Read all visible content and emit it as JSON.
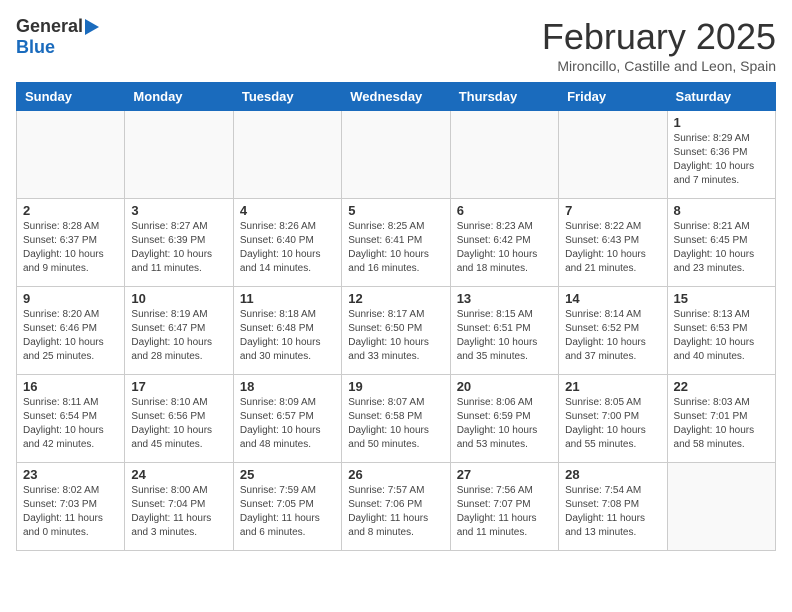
{
  "header": {
    "logo_general": "General",
    "logo_blue": "Blue",
    "title": "February 2025",
    "subtitle": "Mironcillo, Castille and Leon, Spain"
  },
  "weekdays": [
    "Sunday",
    "Monday",
    "Tuesday",
    "Wednesday",
    "Thursday",
    "Friday",
    "Saturday"
  ],
  "weeks": [
    [
      {
        "day": "",
        "info": ""
      },
      {
        "day": "",
        "info": ""
      },
      {
        "day": "",
        "info": ""
      },
      {
        "day": "",
        "info": ""
      },
      {
        "day": "",
        "info": ""
      },
      {
        "day": "",
        "info": ""
      },
      {
        "day": "1",
        "info": "Sunrise: 8:29 AM\nSunset: 6:36 PM\nDaylight: 10 hours and 7 minutes."
      }
    ],
    [
      {
        "day": "2",
        "info": "Sunrise: 8:28 AM\nSunset: 6:37 PM\nDaylight: 10 hours and 9 minutes."
      },
      {
        "day": "3",
        "info": "Sunrise: 8:27 AM\nSunset: 6:39 PM\nDaylight: 10 hours and 11 minutes."
      },
      {
        "day": "4",
        "info": "Sunrise: 8:26 AM\nSunset: 6:40 PM\nDaylight: 10 hours and 14 minutes."
      },
      {
        "day": "5",
        "info": "Sunrise: 8:25 AM\nSunset: 6:41 PM\nDaylight: 10 hours and 16 minutes."
      },
      {
        "day": "6",
        "info": "Sunrise: 8:23 AM\nSunset: 6:42 PM\nDaylight: 10 hours and 18 minutes."
      },
      {
        "day": "7",
        "info": "Sunrise: 8:22 AM\nSunset: 6:43 PM\nDaylight: 10 hours and 21 minutes."
      },
      {
        "day": "8",
        "info": "Sunrise: 8:21 AM\nSunset: 6:45 PM\nDaylight: 10 hours and 23 minutes."
      }
    ],
    [
      {
        "day": "9",
        "info": "Sunrise: 8:20 AM\nSunset: 6:46 PM\nDaylight: 10 hours and 25 minutes."
      },
      {
        "day": "10",
        "info": "Sunrise: 8:19 AM\nSunset: 6:47 PM\nDaylight: 10 hours and 28 minutes."
      },
      {
        "day": "11",
        "info": "Sunrise: 8:18 AM\nSunset: 6:48 PM\nDaylight: 10 hours and 30 minutes."
      },
      {
        "day": "12",
        "info": "Sunrise: 8:17 AM\nSunset: 6:50 PM\nDaylight: 10 hours and 33 minutes."
      },
      {
        "day": "13",
        "info": "Sunrise: 8:15 AM\nSunset: 6:51 PM\nDaylight: 10 hours and 35 minutes."
      },
      {
        "day": "14",
        "info": "Sunrise: 8:14 AM\nSunset: 6:52 PM\nDaylight: 10 hours and 37 minutes."
      },
      {
        "day": "15",
        "info": "Sunrise: 8:13 AM\nSunset: 6:53 PM\nDaylight: 10 hours and 40 minutes."
      }
    ],
    [
      {
        "day": "16",
        "info": "Sunrise: 8:11 AM\nSunset: 6:54 PM\nDaylight: 10 hours and 42 minutes."
      },
      {
        "day": "17",
        "info": "Sunrise: 8:10 AM\nSunset: 6:56 PM\nDaylight: 10 hours and 45 minutes."
      },
      {
        "day": "18",
        "info": "Sunrise: 8:09 AM\nSunset: 6:57 PM\nDaylight: 10 hours and 48 minutes."
      },
      {
        "day": "19",
        "info": "Sunrise: 8:07 AM\nSunset: 6:58 PM\nDaylight: 10 hours and 50 minutes."
      },
      {
        "day": "20",
        "info": "Sunrise: 8:06 AM\nSunset: 6:59 PM\nDaylight: 10 hours and 53 minutes."
      },
      {
        "day": "21",
        "info": "Sunrise: 8:05 AM\nSunset: 7:00 PM\nDaylight: 10 hours and 55 minutes."
      },
      {
        "day": "22",
        "info": "Sunrise: 8:03 AM\nSunset: 7:01 PM\nDaylight: 10 hours and 58 minutes."
      }
    ],
    [
      {
        "day": "23",
        "info": "Sunrise: 8:02 AM\nSunset: 7:03 PM\nDaylight: 11 hours and 0 minutes."
      },
      {
        "day": "24",
        "info": "Sunrise: 8:00 AM\nSunset: 7:04 PM\nDaylight: 11 hours and 3 minutes."
      },
      {
        "day": "25",
        "info": "Sunrise: 7:59 AM\nSunset: 7:05 PM\nDaylight: 11 hours and 6 minutes."
      },
      {
        "day": "26",
        "info": "Sunrise: 7:57 AM\nSunset: 7:06 PM\nDaylight: 11 hours and 8 minutes."
      },
      {
        "day": "27",
        "info": "Sunrise: 7:56 AM\nSunset: 7:07 PM\nDaylight: 11 hours and 11 minutes."
      },
      {
        "day": "28",
        "info": "Sunrise: 7:54 AM\nSunset: 7:08 PM\nDaylight: 11 hours and 13 minutes."
      },
      {
        "day": "",
        "info": ""
      }
    ]
  ]
}
